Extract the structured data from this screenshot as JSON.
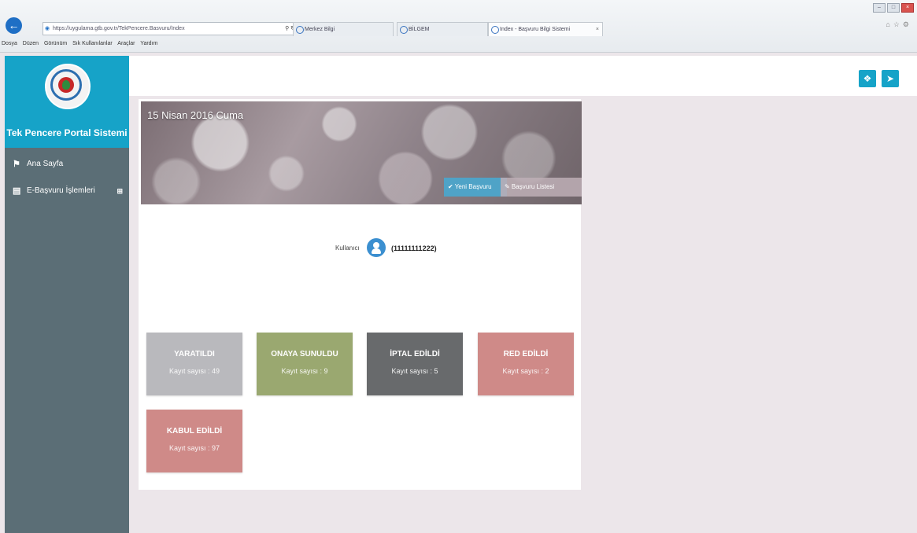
{
  "browser": {
    "address": "https://uygulama.gtb.gov.tr/TekPencere.Basvuru/Index",
    "tabs": [
      {
        "label": "Merkez Bilgi"
      },
      {
        "label": "BİLGEM"
      },
      {
        "label": "Index - Başvuru Bilgi Sistemi"
      }
    ],
    "menu": [
      "Dosya",
      "Düzen",
      "Görünüm",
      "Sık Kullanılanlar",
      "Araçlar",
      "Yardım"
    ]
  },
  "sidebar": {
    "brand_title": "Tek Pencere Portal Sistemi",
    "items": [
      {
        "label": "Ana Sayfa",
        "icon": "home-icon"
      },
      {
        "label": "E-Başvuru İşlemleri",
        "icon": "chart-icon"
      }
    ]
  },
  "header": {
    "buttons": [
      {
        "icon": "fullscreen-icon"
      },
      {
        "icon": "logout-icon"
      }
    ]
  },
  "banner": {
    "date": "15 Nisan 2016 Cuma",
    "new_button": "✔ Yeni Başvuru",
    "list_button": "✎ Başvuru Listesi"
  },
  "user": {
    "label": "Kullanıcı",
    "id": "(11111111222)"
  },
  "stats": [
    {
      "title": "YARATILDI",
      "count": "Kayıt sayısı : 49",
      "color": "#b9b9bd"
    },
    {
      "title": "ONAYA SUNULDU",
      "count": "Kayıt sayısı : 9",
      "color": "#9aa870"
    },
    {
      "title": "İPTAL EDİLDİ",
      "count": "Kayıt sayısı : 5",
      "color": "#686a6c"
    },
    {
      "title": "RED EDİLDİ",
      "count": "Kayıt sayısı : 2",
      "color": "#cf8a88"
    },
    {
      "title": "KABUL EDİLDİ",
      "count": "Kayıt sayısı : 97",
      "color": "#cf8a88"
    }
  ]
}
